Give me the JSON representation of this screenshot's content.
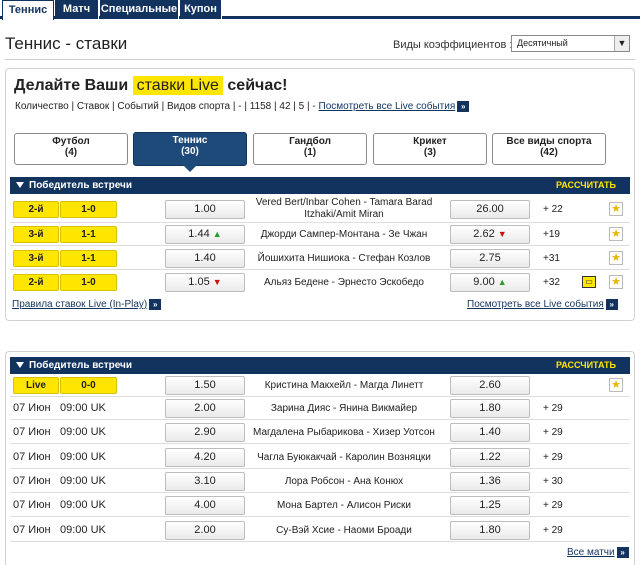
{
  "nav_tabs": [
    {
      "label": "Теннис"
    },
    {
      "label": "Матч"
    },
    {
      "label": "Специальные"
    },
    {
      "label": "Купон"
    }
  ],
  "page": {
    "title": "Теннис - ставки",
    "odds_label": "Виды коэффициентов :",
    "odds_value": "Десятичный"
  },
  "promo": {
    "pre": "Делайте Ваши",
    "highlight": "ставки Live",
    "post": "сейчас!",
    "stats": "Количество | Ставок | Событий | Видов спорта | - | 1158 | 42 | 5 | -",
    "all_live": "Посмотреть все Live события"
  },
  "sport_tabs": [
    {
      "name": "Футбол",
      "count": "(4)"
    },
    {
      "name": "Теннис",
      "count": "(30)"
    },
    {
      "name": "Гандбол",
      "count": "(1)"
    },
    {
      "name": "Крикет",
      "count": "(3)"
    },
    {
      "name": "Все виды спорта",
      "count": "(42)"
    }
  ],
  "live_section": {
    "header": "Победитель встречи",
    "calc": "РАССЧИТАТЬ",
    "rules_link": "Правила ставок Live (In-Play)",
    "all_link": "Посмотреть все Live события",
    "rows": [
      {
        "set": "2-й",
        "score": "1-0",
        "odd1": "1.00",
        "dir1": "",
        "match": "Vered Bert/Inbar Cohen  -  Tamara Barad Itzhaki/Amit Miran",
        "odd2": "26.00",
        "dir2": "",
        "more": "+ 22",
        "tv": false
      },
      {
        "set": "3-й",
        "score": "1-1",
        "odd1": "1.44",
        "dir1": "▲",
        "match": "Джорди Сампер-Монтана  -  Зе Чжан",
        "odd2": "2.62",
        "dir2": "▼",
        "more": "+19",
        "tv": false
      },
      {
        "set": "3-й",
        "score": "1-1",
        "odd1": "1.40",
        "dir1": "",
        "match": "Йошихита Нишиока  -  Стефан Козлов",
        "odd2": "2.75",
        "dir2": "",
        "more": "+31",
        "tv": false
      },
      {
        "set": "2-й",
        "score": "1-0",
        "odd1": "1.05",
        "dir1": "▼",
        "match": "Альяз Бедене  -  Эрнесто Эскобедо",
        "odd2": "9.00",
        "dir2": "▲",
        "more": "+32",
        "tv": true
      }
    ]
  },
  "upcoming_section": {
    "header": "Победитель встречи",
    "calc": "РАССЧИТАТЬ",
    "all_link": "Все матчи",
    "live_row": {
      "live": "Live",
      "score": "0-0",
      "odd1": "1.50",
      "match": "Кристина Макхейл  -  Магда Линетт",
      "odd2": "2.60"
    },
    "rows": [
      {
        "date": "07 Июн",
        "time": "09:00 UK",
        "odd1": "2.00",
        "match": "Зарина Дияс  -  Янина Викмайер",
        "odd2": "1.80",
        "more": "+ 29"
      },
      {
        "date": "07 Июн",
        "time": "09:00 UK",
        "odd1": "2.90",
        "match": "Магдалена Рыбарикова  -  Хизер Уотсон",
        "odd2": "1.40",
        "more": "+ 29"
      },
      {
        "date": "07 Июн",
        "time": "09:00 UK",
        "odd1": "4.20",
        "match": "Чагла Буюкакчай  -  Каролин Возняцки",
        "odd2": "1.22",
        "more": "+ 29"
      },
      {
        "date": "07 Июн",
        "time": "09:00 UK",
        "odd1": "3.10",
        "match": "Лора Робсон  -  Ана Конюх",
        "odd2": "1.36",
        "more": "+ 30"
      },
      {
        "date": "07 Июн",
        "time": "09:00 UK",
        "odd1": "4.00",
        "match": "Мона Бартел  -  Алисон Риски",
        "odd2": "1.25",
        "more": "+ 29"
      },
      {
        "date": "07 Июн",
        "time": "09:00 UK",
        "odd1": "2.00",
        "match": "Су-Вэй Хсие  -  Наоми Броади",
        "odd2": "1.80",
        "more": "+ 29"
      }
    ]
  }
}
